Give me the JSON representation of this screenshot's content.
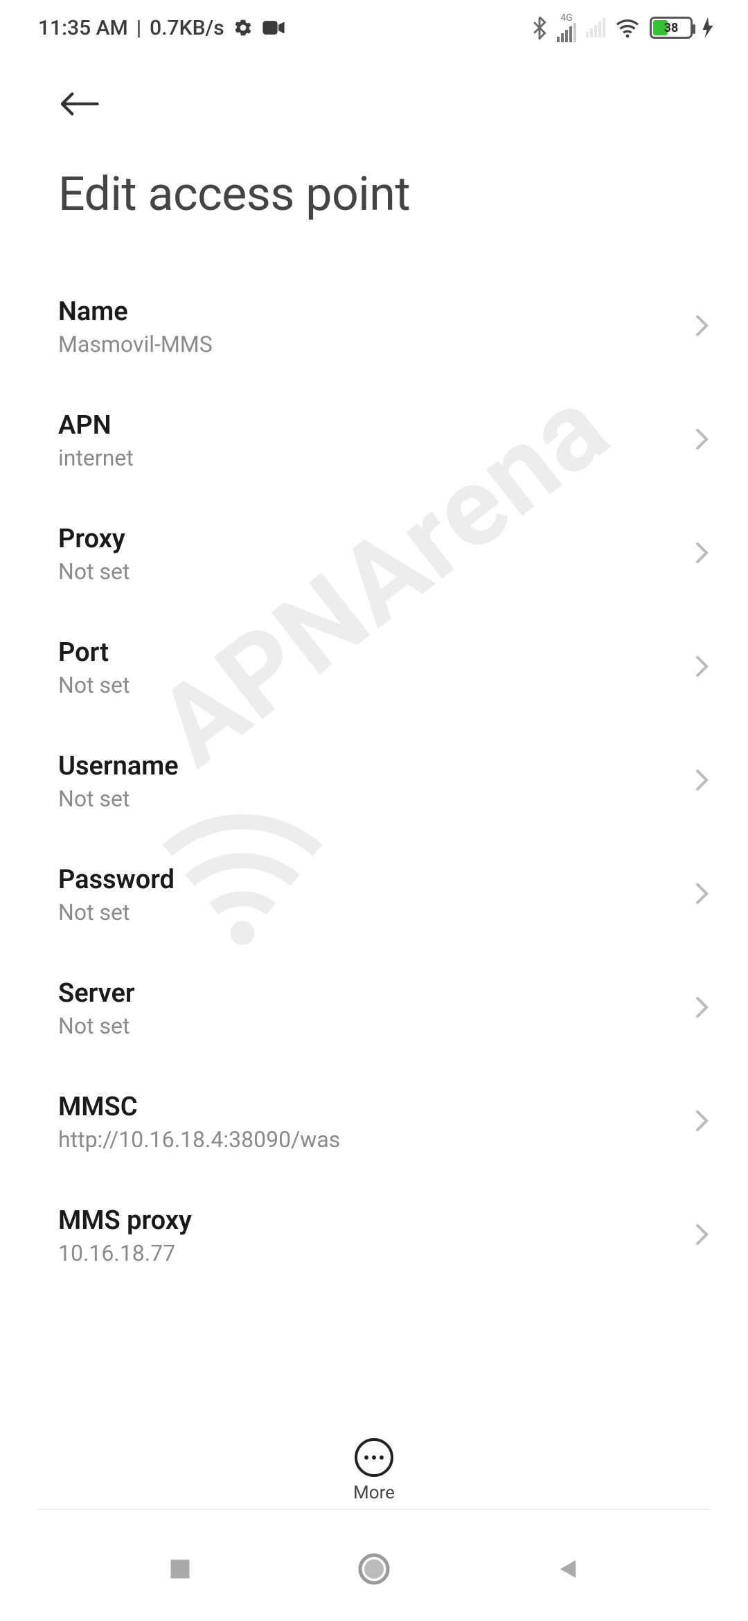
{
  "status": {
    "time": "11:35 AM",
    "sep": "|",
    "speed": "0.7KB/s",
    "battery_pct": "38",
    "network_label": "4G"
  },
  "page": {
    "title": "Edit access point"
  },
  "settings": [
    {
      "label": "Name",
      "value": "Masmovil-MMS"
    },
    {
      "label": "APN",
      "value": "internet"
    },
    {
      "label": "Proxy",
      "value": "Not set"
    },
    {
      "label": "Port",
      "value": "Not set"
    },
    {
      "label": "Username",
      "value": "Not set"
    },
    {
      "label": "Password",
      "value": "Not set"
    },
    {
      "label": "Server",
      "value": "Not set"
    },
    {
      "label": "MMSC",
      "value": "http://10.16.18.4:38090/was"
    },
    {
      "label": "MMS proxy",
      "value": "10.16.18.77"
    }
  ],
  "bottom": {
    "more": "More"
  },
  "watermark": "APNArena"
}
